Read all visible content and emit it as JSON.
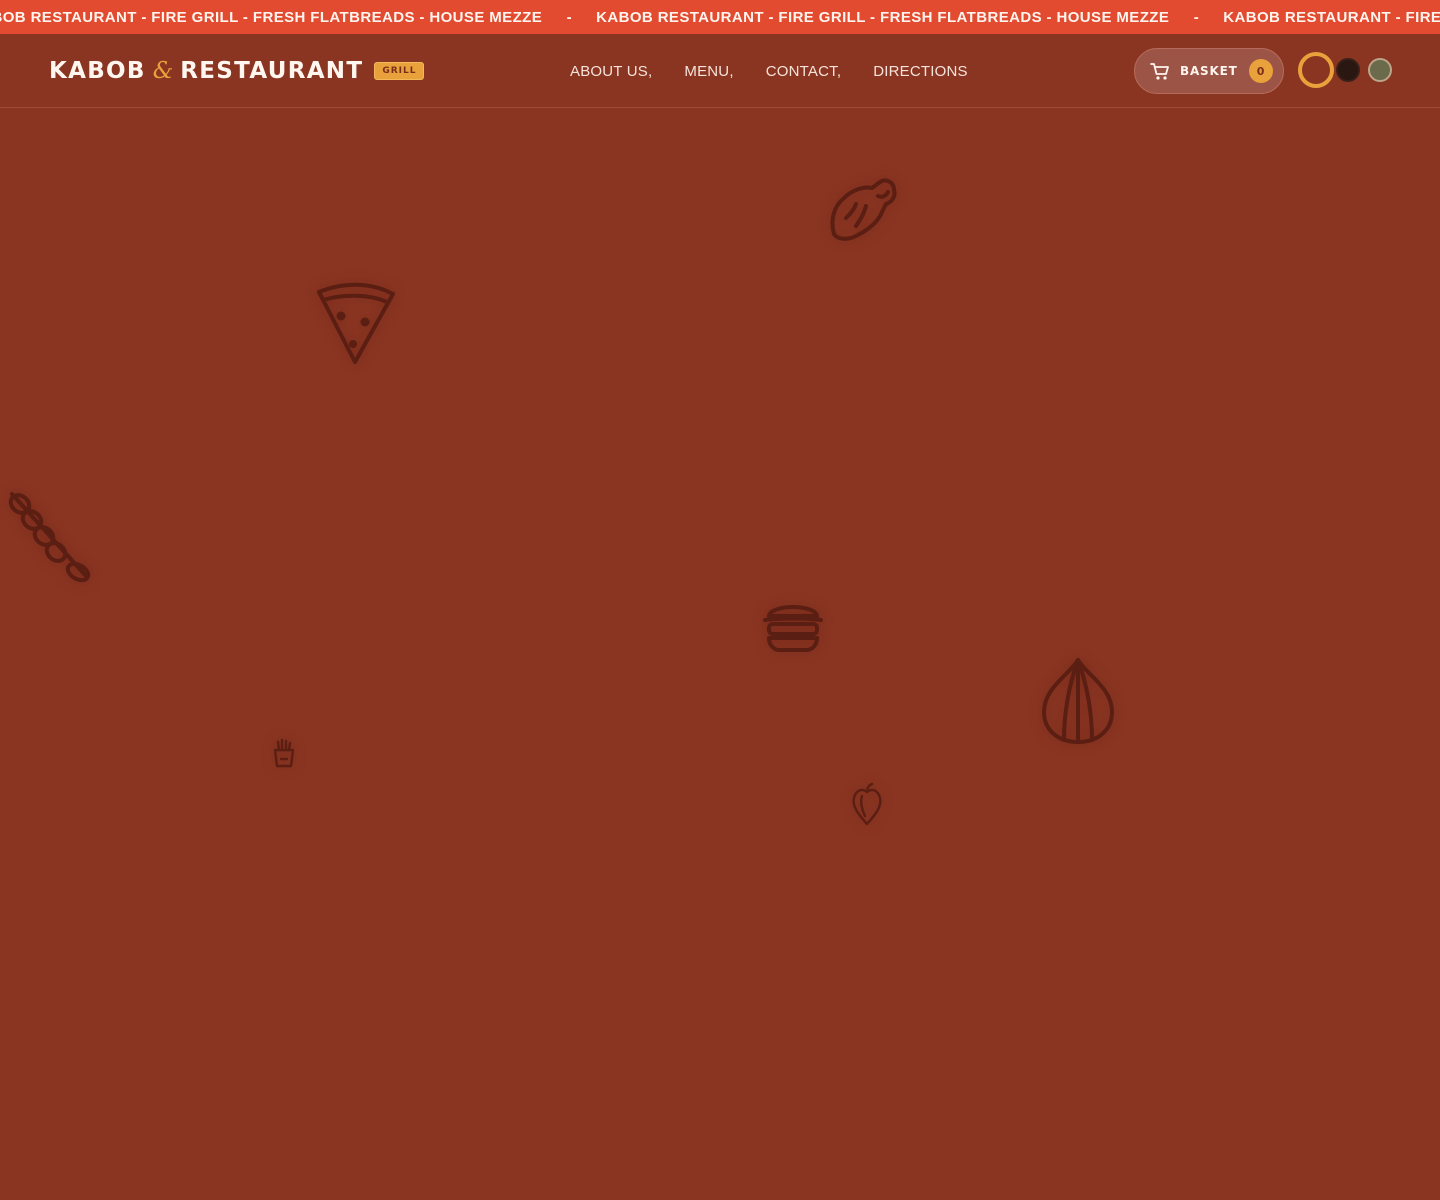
{
  "ticker": {
    "items": [
      "KABOB RESTAURANT - FIRE GRILL - FRESH FLATBREADS - HOUSE MEZZE",
      "KABOB RESTAURANT - FIRE GRILL - FRESH FLATBREADS - HOUSE MEZZE",
      "KABOB RESTAURANT - FIRE GRILL - FRESH FLATBREADS - HOUSE MEZZE"
    ],
    "separator": "-",
    "background": "#e24b2f"
  },
  "header": {
    "logo": {
      "word1": "KABOB",
      "amp": "&",
      "word2": "RESTAURANT",
      "badge": "GRILL"
    },
    "nav": [
      {
        "label": "ABOUT US,"
      },
      {
        "label": "MENU,"
      },
      {
        "label": "CONTACT,"
      },
      {
        "label": "DIRECTIONS"
      }
    ],
    "basket": {
      "label": "BASKET",
      "count": "0",
      "icon": "cart-icon"
    },
    "theme_swatches": [
      {
        "name": "ember",
        "color": "#e9a23b",
        "active": true
      },
      {
        "name": "charcoal",
        "color": "#2a1712",
        "active": false
      },
      {
        "name": "olive",
        "color": "#6b6a4b",
        "active": false
      }
    ]
  },
  "colors": {
    "background": "#8a3522",
    "accent": "#e9a23b",
    "doodle": "#5b1e12"
  },
  "doodles": [
    "chicken-leg-icon",
    "pizza-slice-icon",
    "skewer-icon",
    "burger-icon",
    "onion-icon",
    "fries-icon",
    "pepper-icon"
  ]
}
